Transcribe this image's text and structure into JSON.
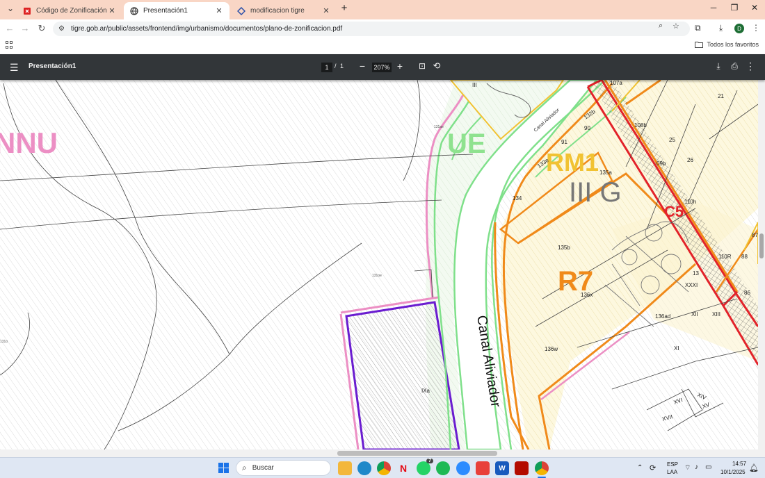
{
  "browser": {
    "tabs": [
      {
        "title": "Código de Zonificación - Tigre",
        "active": false
      },
      {
        "title": "Presentación1",
        "active": true
      },
      {
        "title": "modificacion tigre",
        "active": false
      }
    ],
    "url": "tigre.gob.ar/public/assets/frontend/img/urbanismo/documentos/plano-de-zonificacion.pdf",
    "profile_initial": "D",
    "bookmarks_folder": "Todos los favoritos"
  },
  "pdf": {
    "title": "Presentación1",
    "current_page": "1",
    "page_separator": "/",
    "total_pages": "1",
    "zoom": "207%"
  },
  "map": {
    "zones": {
      "annu": "NNU",
      "ue": "UE",
      "rm1": "RM1",
      "iiig": "III G",
      "c5": "C5",
      "r7": "R7"
    },
    "canal_big": "Canal Aliviador",
    "canal_small": "Canal Aliviador",
    "parcels": {
      "p107a": "107a",
      "p21": "21",
      "p108b": "108b",
      "p132b": "132b",
      "p90": "90",
      "p91": "91",
      "p25": "25",
      "p26": "26",
      "p109b": "09b",
      "p133e": "133e",
      "p135a": "135a",
      "p134": "134",
      "p110h": "110h",
      "p135b": "135b",
      "p110r": "110R",
      "p88": "88",
      "p87": "87",
      "p86": "86",
      "p136x": "136x",
      "p136ad": "136ad",
      "pxii": "XII",
      "pxiii": "XIII",
      "pxxxi": "XXXI",
      "p13": "13",
      "p136w": "136w",
      "pxi": "XI",
      "pxiv": "XIV",
      "pxv": "XV",
      "pxvi": "XVI",
      "pxvii": "XVII",
      "pixa": "IXa",
      "piii": "III",
      "p131a": "131ae",
      "p131oe": "131oe",
      "p131o": "131o"
    },
    "colors": {
      "pink": "#ec8fc4",
      "green": "#7fe08a",
      "orange": "#f08a1a",
      "red": "#e2232a",
      "purple": "#6a1cd0",
      "yellow": "#f1c232"
    }
  },
  "taskbar": {
    "search_placeholder": "Buscar",
    "lang": "ESP",
    "lang_sub": "LAA",
    "time": "14:57",
    "date": "10/1/2025",
    "whatsapp_badge": "7"
  }
}
